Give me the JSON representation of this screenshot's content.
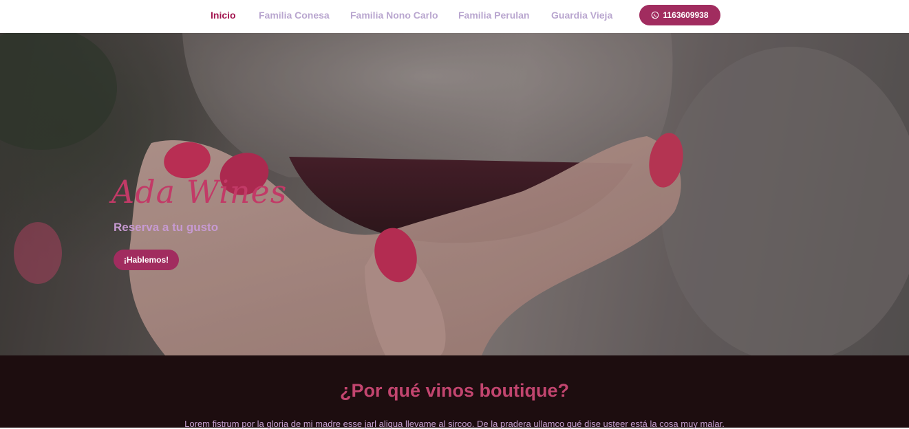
{
  "nav": {
    "links": [
      {
        "label": "Inicio",
        "active": true
      },
      {
        "label": "Familia Conesa",
        "active": false
      },
      {
        "label": "Familia Nono Carlo",
        "active": false
      },
      {
        "label": "Familia Perulan",
        "active": false
      },
      {
        "label": "Guardia Vieja",
        "active": false
      }
    ],
    "whatsapp": {
      "icon": "whatsapp-icon",
      "label": "1163609938"
    }
  },
  "hero": {
    "title": "Ada Wines",
    "subtitle": "Reserva a tu gusto",
    "cta_label": "¡Hablemos!"
  },
  "section": {
    "title": "¿Por qué vinos boutique?",
    "text": "Lorem fistrum por la gloria de mi madre esse jarl aliqua llevame al sircoo. De la pradera ullamco qué dise usteer está la cosa muy malar."
  },
  "colors": {
    "accent": "#a12c5f",
    "nav_active": "#a3154f",
    "nav_inactive": "#b9a6cf",
    "title_pink": "#c23a67",
    "section_bg": "#1d0d0f"
  }
}
